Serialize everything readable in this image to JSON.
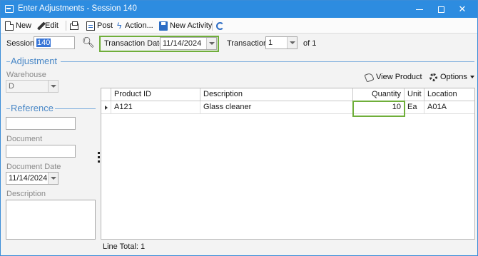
{
  "window": {
    "title": "Enter Adjustments - Session 140"
  },
  "toolbar": {
    "new_label": "New",
    "edit_label": "Edit",
    "post_label": "Post",
    "action_label": "Action...",
    "new_activity_label": "New Activity"
  },
  "header": {
    "session_label": "Session",
    "session_value": "140",
    "transaction_date_label": "Transaction Date",
    "transaction_date_value": "11/14/2024",
    "transaction_label": "Transaction",
    "transaction_value": "1",
    "transaction_of": "of 1"
  },
  "adjustment": {
    "title": "Adjustment",
    "warehouse_label": "Warehouse",
    "warehouse_value": "D"
  },
  "reference": {
    "title": "Reference",
    "document_label": "Document",
    "document_date_label": "Document Date",
    "document_date_value": "11/14/2024",
    "description_label": "Description"
  },
  "grid_tools": {
    "view_product_label": "View Product",
    "options_label": "Options"
  },
  "grid": {
    "columns": [
      "Product ID",
      "Description",
      "Quantity",
      "Unit",
      "Location"
    ],
    "rows": [
      [
        "A121",
        "Glass cleaner",
        "10",
        "Ea",
        "A01A"
      ]
    ]
  },
  "footer": {
    "line_total": "Line Total: 1"
  },
  "colors": {
    "titlebar": "#2d8ce0",
    "highlight": "#6fae3a",
    "section": "#4a88c7"
  }
}
